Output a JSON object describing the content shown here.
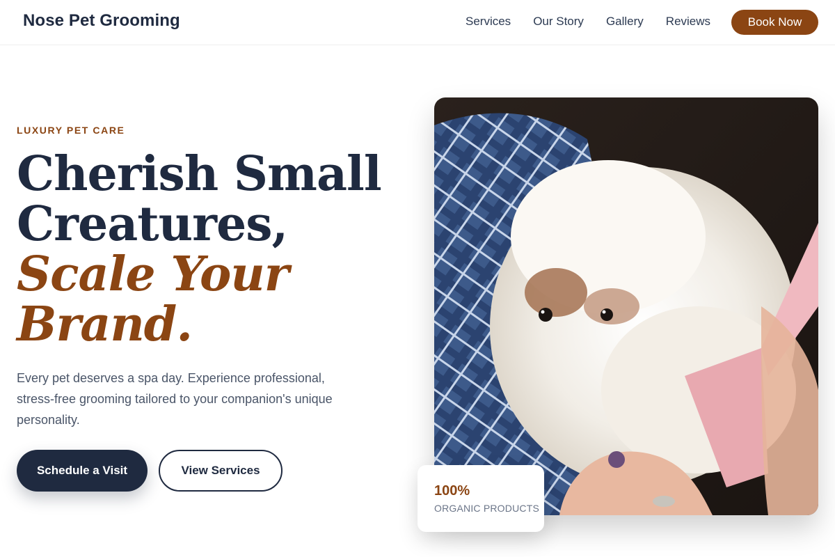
{
  "header": {
    "brand": "Nose Pet Grooming",
    "nav": [
      "Services",
      "Our Story",
      "Gallery",
      "Reviews"
    ],
    "cta": "Book Now"
  },
  "hero": {
    "eyebrow": "LUXURY PET CARE",
    "headline_line1": "Cherish Small",
    "headline_line2": "Creatures,",
    "headline_accent1": "Scale Your",
    "headline_accent2": "Brand.",
    "lede": "Every pet deserves a spa day. Experience professional, stress-free grooming tailored to your companion's unique personality.",
    "primary_cta": "Schedule a Visit",
    "secondary_cta": "View Services",
    "image_subject": "fluffy white dog being brushed on blue plaid blanket"
  },
  "stat": {
    "value": "100%",
    "label": "ORGANIC PRODUCTS"
  },
  "colors": {
    "accent": "#8b4513",
    "navy": "#1f2a40",
    "text_muted": "#4a5568"
  }
}
